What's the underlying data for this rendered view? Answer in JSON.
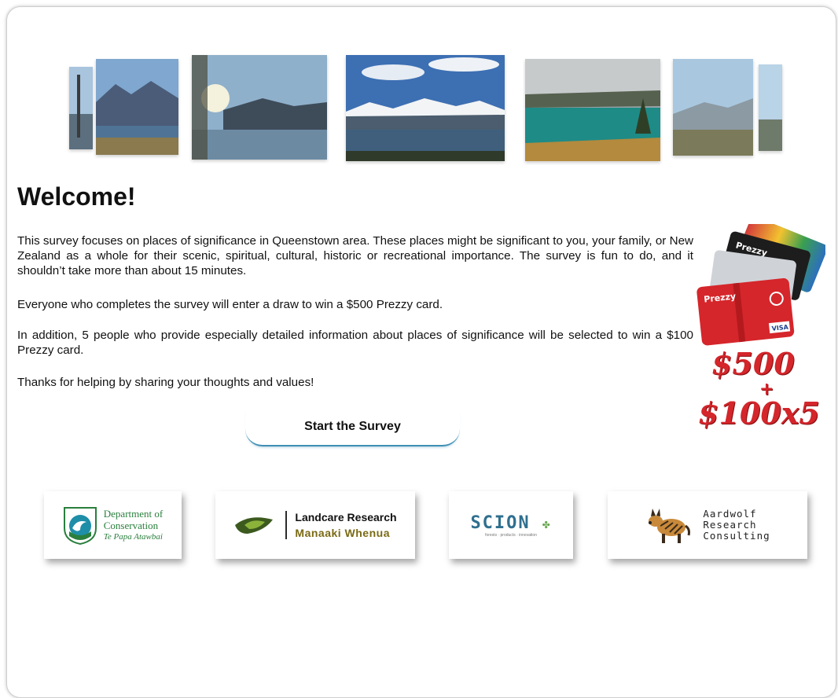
{
  "heading": "Welcome!",
  "paragraphs": [
    "This survey focuses on places of significance in Queenstown area. These places might be significant to you, your family, or New Zealand as a whole for their scenic, spiritual, cultural, historic or recreational importance. The survey is fun to do, and it shouldn’t take more than about 15 minutes.",
    "Everyone who completes the survey will enter a draw to win a $500 Prezzy card.",
    "In addition, 5 people who provide especially detailed information about places of significance will be selected to win a $100 Prezzy card.",
    "Thanks for helping by sharing your thoughts and values!"
  ],
  "start_button": "Start the Survey",
  "prize": {
    "line1": "$500",
    "plus": "+",
    "line2": "$100x5"
  },
  "cards": {
    "brand": "Prezzy",
    "network": "VISA"
  },
  "logos": {
    "doc": {
      "line1": "Department of",
      "line2": "Conservation",
      "line3": "Te Papa Atawbai"
    },
    "landcare": {
      "line1": "Landcare Research",
      "line2": "Manaaki Whenua"
    },
    "scion": {
      "name": "SCION",
      "tagline": "forests · products · innovation"
    },
    "aardwolf": {
      "line1": "Aardwolf",
      "line2": "Research",
      "line3": "Consulting"
    }
  },
  "colors": {
    "button_underline": "#3f8fb5",
    "prize_red": "#d4262b",
    "doc_green": "#2a7f3d"
  }
}
